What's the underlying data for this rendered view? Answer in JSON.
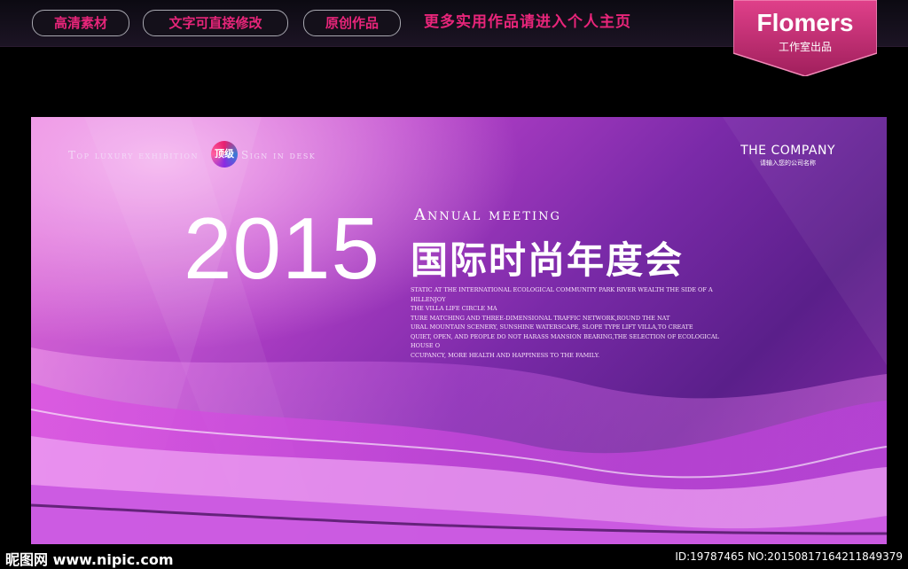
{
  "header": {
    "pills": [
      "高清素材",
      "文字可直接修改",
      "原创作品"
    ],
    "link": "更多实用作品请进入个人主页",
    "brand": {
      "title": "Flomers",
      "subtitle": "工作室出品"
    }
  },
  "banner": {
    "tagline_left": "Top luxury exhibition",
    "seal": "顶级",
    "tagline_right": "Sign in desk",
    "company_name": "THE COMPANY",
    "company_sub": "请输入您的公司名称",
    "year": "2015",
    "annual": "Annual meeting",
    "cn_title": "国际时尚年度会",
    "description": [
      "STATIC AT THE INTERNATIONAL ECOLOGICAL COMMUNITY PARK RIVER WEALTH THE SIDE OF A HILLENJOY",
      "THE VILLA LIFE CIRCLE MA",
      "TURE MATCHING AND THREE-DIMENSIONAL TRAFFIC NETWORK,ROUND THE NAT",
      "URAL MOUNTAIN SCENERY, SUNSHINE WATERSCAPE, SLOPE TYPE LIFT VILLA,TO CREATE",
      "QUIET, OPEN, AND PEOPLE DO NOT HARASS MANSION BEARING,THE SELECTION OF ECOLOGICAL HOUSE O",
      "CCUPANCY, MORE HEALTH AND HAPPINESS TO THE FAMILY."
    ]
  },
  "footer": {
    "watermark_left": "昵图网 www.nipic.com",
    "watermark_right": "ID:19787465 NO:20150817164211849379"
  }
}
